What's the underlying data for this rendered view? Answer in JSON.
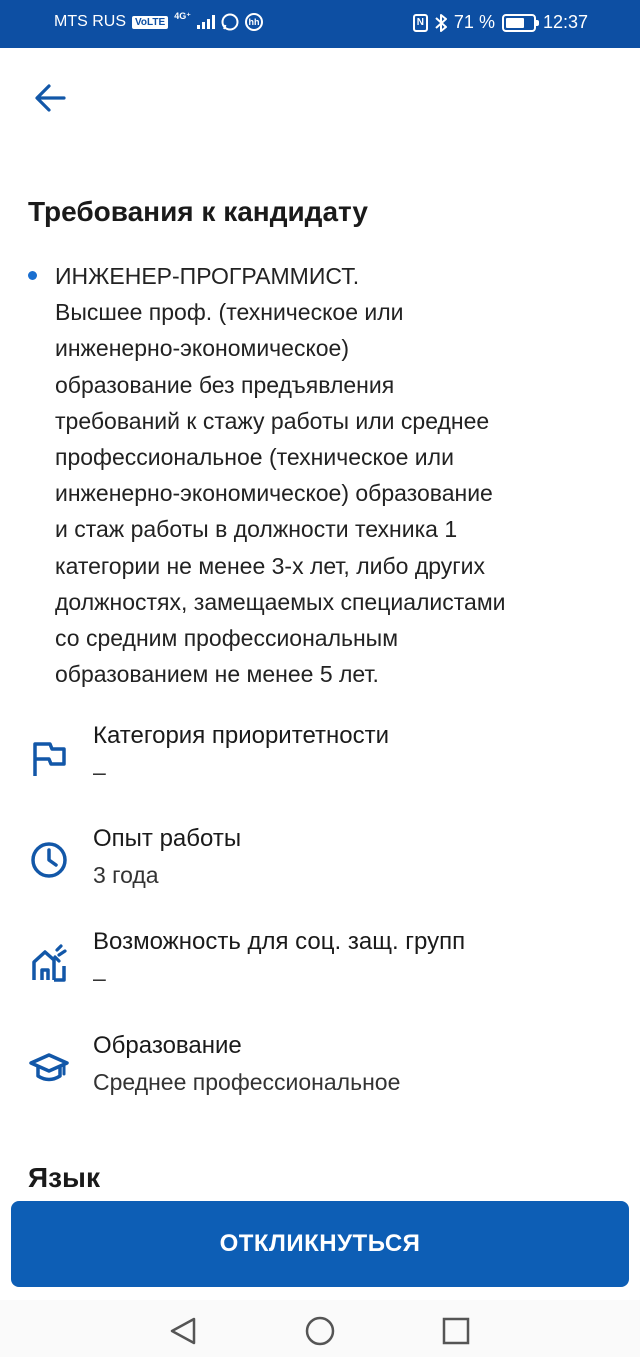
{
  "status_bar": {
    "carrier": "MTS RUS",
    "volte": "VoLTE",
    "network": "4G⁺",
    "hh_icon_label": "hh",
    "nfc_label": "N",
    "battery_text": "71 %",
    "battery_level_percent": 71,
    "time": "12:37"
  },
  "header": {
    "back_icon": "arrow-left-icon"
  },
  "requirements": {
    "title": "Требования к кандидату",
    "items": [
      "ИНЖЕНЕР-ПРОГРАММИСТ.\nВысшее проф. (техническое или\nинженерно-экономическое)\nобразование без предъявления\nтребований к стажу работы или среднее\nпрофессиональное (техническое или\nинженерно-экономическое) образование\nи стаж работы в должности техника 1\nкатегории не менее 3-х лет, либо других\nдолжностях, замещаемых специалистами\nсо средним профессиональным\nобразованием не менее 5 лет."
    ]
  },
  "info": {
    "priority": {
      "label": "Категория приоритетности",
      "value": "–",
      "icon": "flag-icon"
    },
    "experience": {
      "label": "Опыт работы",
      "value": "3 года",
      "icon": "clock-icon"
    },
    "social": {
      "label": "Возможность для соц. защ. групп",
      "value": "–",
      "icon": "house-icon"
    },
    "education": {
      "label": "Образование",
      "value": "Среднее профессиональное",
      "icon": "graduation-cap-icon"
    }
  },
  "language": {
    "title": "Язык"
  },
  "apply_button": {
    "label": "ОТКЛИКНУТЬСЯ"
  },
  "nav_bar": {
    "icons": [
      "nav-back-icon",
      "nav-home-icon",
      "nav-recents-icon"
    ]
  },
  "colors": {
    "primary": "#0d5eb5",
    "status_bar": "#0d4fa3",
    "accent_icon": "#1257a8",
    "bullet": "#1a6fd0"
  }
}
